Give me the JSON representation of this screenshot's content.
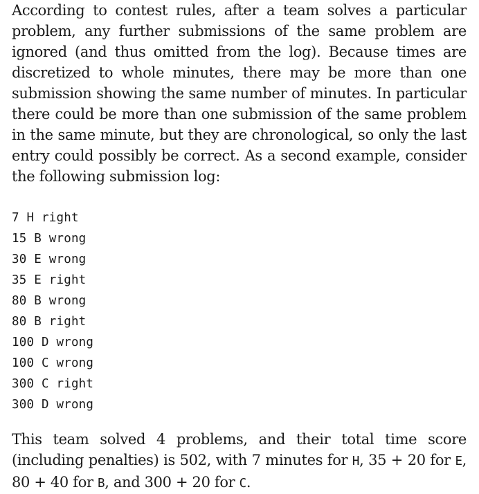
{
  "intro_paragraph": "According to contest rules, after a team solves a particular problem, any further submissions of the same problem are ignored (and thus omitted from the log). Because times are discretized to whole minutes, there may be more than one submission showing the same number of minutes. In particular there could be more than one submission of the same problem in the same minute, but they are chronological, so only the last entry could possibly be correct. As a second example, consider the following submission log:",
  "submission_log": [
    {
      "minute": "7",
      "problem": "H",
      "result": "right"
    },
    {
      "minute": "15",
      "problem": "B",
      "result": "wrong"
    },
    {
      "minute": "30",
      "problem": "E",
      "result": "wrong"
    },
    {
      "minute": "35",
      "problem": "E",
      "result": "right"
    },
    {
      "minute": "80",
      "problem": "B",
      "result": "wrong"
    },
    {
      "minute": "80",
      "problem": "B",
      "result": "right"
    },
    {
      "minute": "100",
      "problem": "D",
      "result": "wrong"
    },
    {
      "minute": "100",
      "problem": "C",
      "result": "wrong"
    },
    {
      "minute": "300",
      "problem": "C",
      "result": "right"
    },
    {
      "minute": "300",
      "problem": "D",
      "result": "wrong"
    }
  ],
  "summary": {
    "part1": "This team solved ",
    "solved_count": "4",
    "part2": " problems, and their total time score (including penalties) is ",
    "total_score": "502",
    "part3": ", with ",
    "h_time": "7",
    "part4": " minutes for ",
    "h_label": "H",
    "part5": ", ",
    "e_time": "35 + 20",
    "part6": " for ",
    "e_label": "E",
    "part7": ", ",
    "b_time": "80 + 40",
    "part8": " for ",
    "b_label": "B",
    "part9": ", and ",
    "c_time": "300 + 20",
    "part10": " for ",
    "c_label": "C",
    "part11": "."
  }
}
